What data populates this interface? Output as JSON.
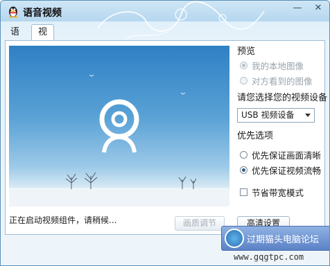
{
  "window": {
    "title": "语音视频"
  },
  "tabs": [
    {
      "label": "语音",
      "active": false
    },
    {
      "label": "视频",
      "active": true
    }
  ],
  "preview": {
    "status_text": "正在启动视频组件，请稍候..."
  },
  "sidebar": {
    "preview_heading": "预览",
    "preview_options": [
      {
        "label": "我的本地图像",
        "selected": true,
        "enabled": false
      },
      {
        "label": "对方看到的图像",
        "selected": false,
        "enabled": false
      }
    ],
    "device_heading": "请您选择您的视频设备",
    "device_select_value": "USB 视频设备",
    "priority_heading": "优先选项",
    "priority_options": [
      {
        "label": "优先保证画面清晰",
        "selected": false
      },
      {
        "label": "优先保证视频流畅",
        "selected": true
      }
    ],
    "bandwidth_label": "节省带宽模式",
    "bandwidth_checked": false
  },
  "buttons": {
    "quality_adjust": "画质调节",
    "advanced": "高清设置"
  },
  "watermark": {
    "site_name": "过期猫头电脑论坛",
    "site_url": "www.gqgtpc.com"
  },
  "colors": {
    "title_bar": "#b5d7ef",
    "preview_sky": "#5aa2d6",
    "accent": "#2f5b85"
  },
  "icons": {
    "app": "qq-penguin-icon",
    "minimize": "minimize-icon",
    "close": "close-icon",
    "camera": "webcam-icon",
    "dropdown": "chevron-down-icon"
  }
}
